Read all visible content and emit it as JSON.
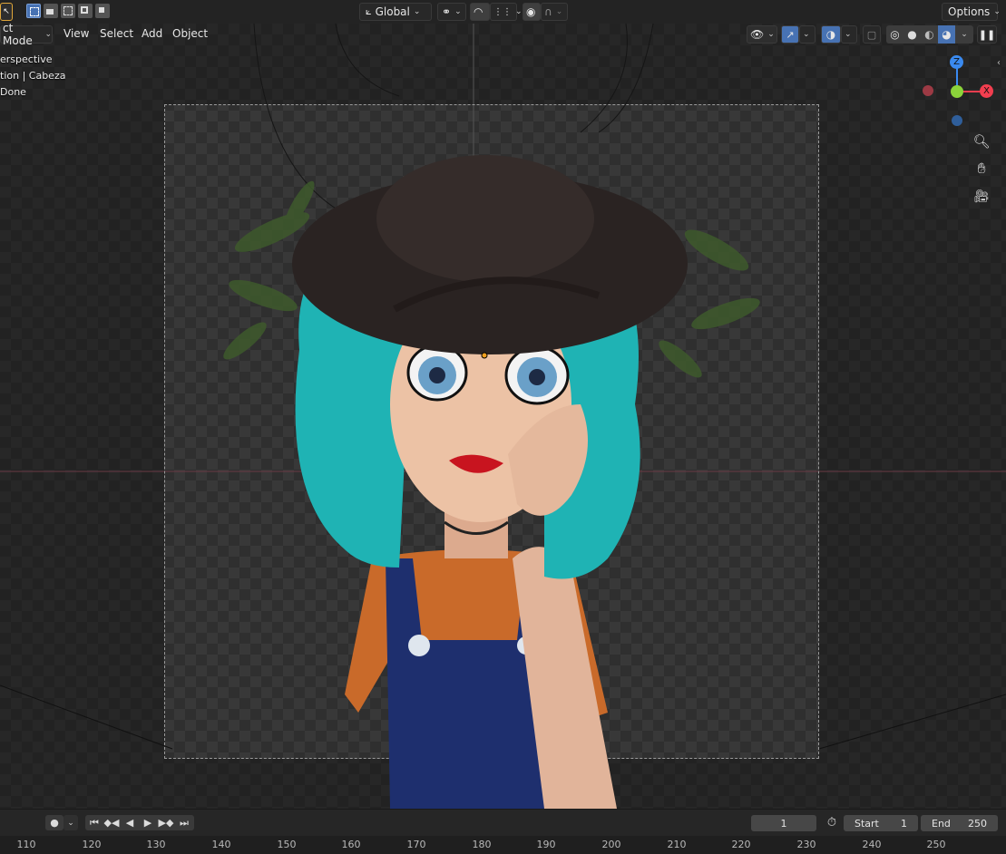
{
  "header": {
    "transform_orientation": "Global",
    "options_label": "Options",
    "mode": "ct Mode",
    "menu": [
      "View",
      "Select",
      "Add",
      "Object"
    ]
  },
  "viewport_overlay": {
    "line1": "erspective",
    "line2": "tion | Cabeza",
    "line3": "Done"
  },
  "gizmo": {
    "z_label": "Z",
    "x_label": "X",
    "colors": {
      "x": "#f23e4f",
      "y": "#8bd33a",
      "z": "#3a8af0",
      "neg_x": "#9c3a44",
      "neg_z": "#2f5e9a"
    }
  },
  "timeline": {
    "current_frame": "1",
    "start_label": "Start",
    "start_value": "1",
    "end_label": "End",
    "end_value": "250",
    "ruler": [
      "110",
      "120",
      "130",
      "140",
      "150",
      "160",
      "170",
      "180",
      "190",
      "200",
      "210",
      "220",
      "230",
      "240",
      "250"
    ]
  },
  "icons": [
    "select-cursor-icon",
    "select-box-icon",
    "transform-pivot-icon",
    "snap-icon",
    "proportional-edit-icon",
    "visibility-icon",
    "gizmo-icon",
    "overlay-icon",
    "xray-icon",
    "wireframe-shading-icon",
    "solid-shading-icon",
    "material-shading-icon",
    "rendered-shading-icon",
    "zoom-icon",
    "hand-pan-icon",
    "camera-view-icon",
    "keyframe-record-icon",
    "jump-start-icon",
    "prev-keyframe-icon",
    "play-reverse-icon",
    "play-icon",
    "next-keyframe-icon",
    "jump-end-icon",
    "stopwatch-icon"
  ]
}
